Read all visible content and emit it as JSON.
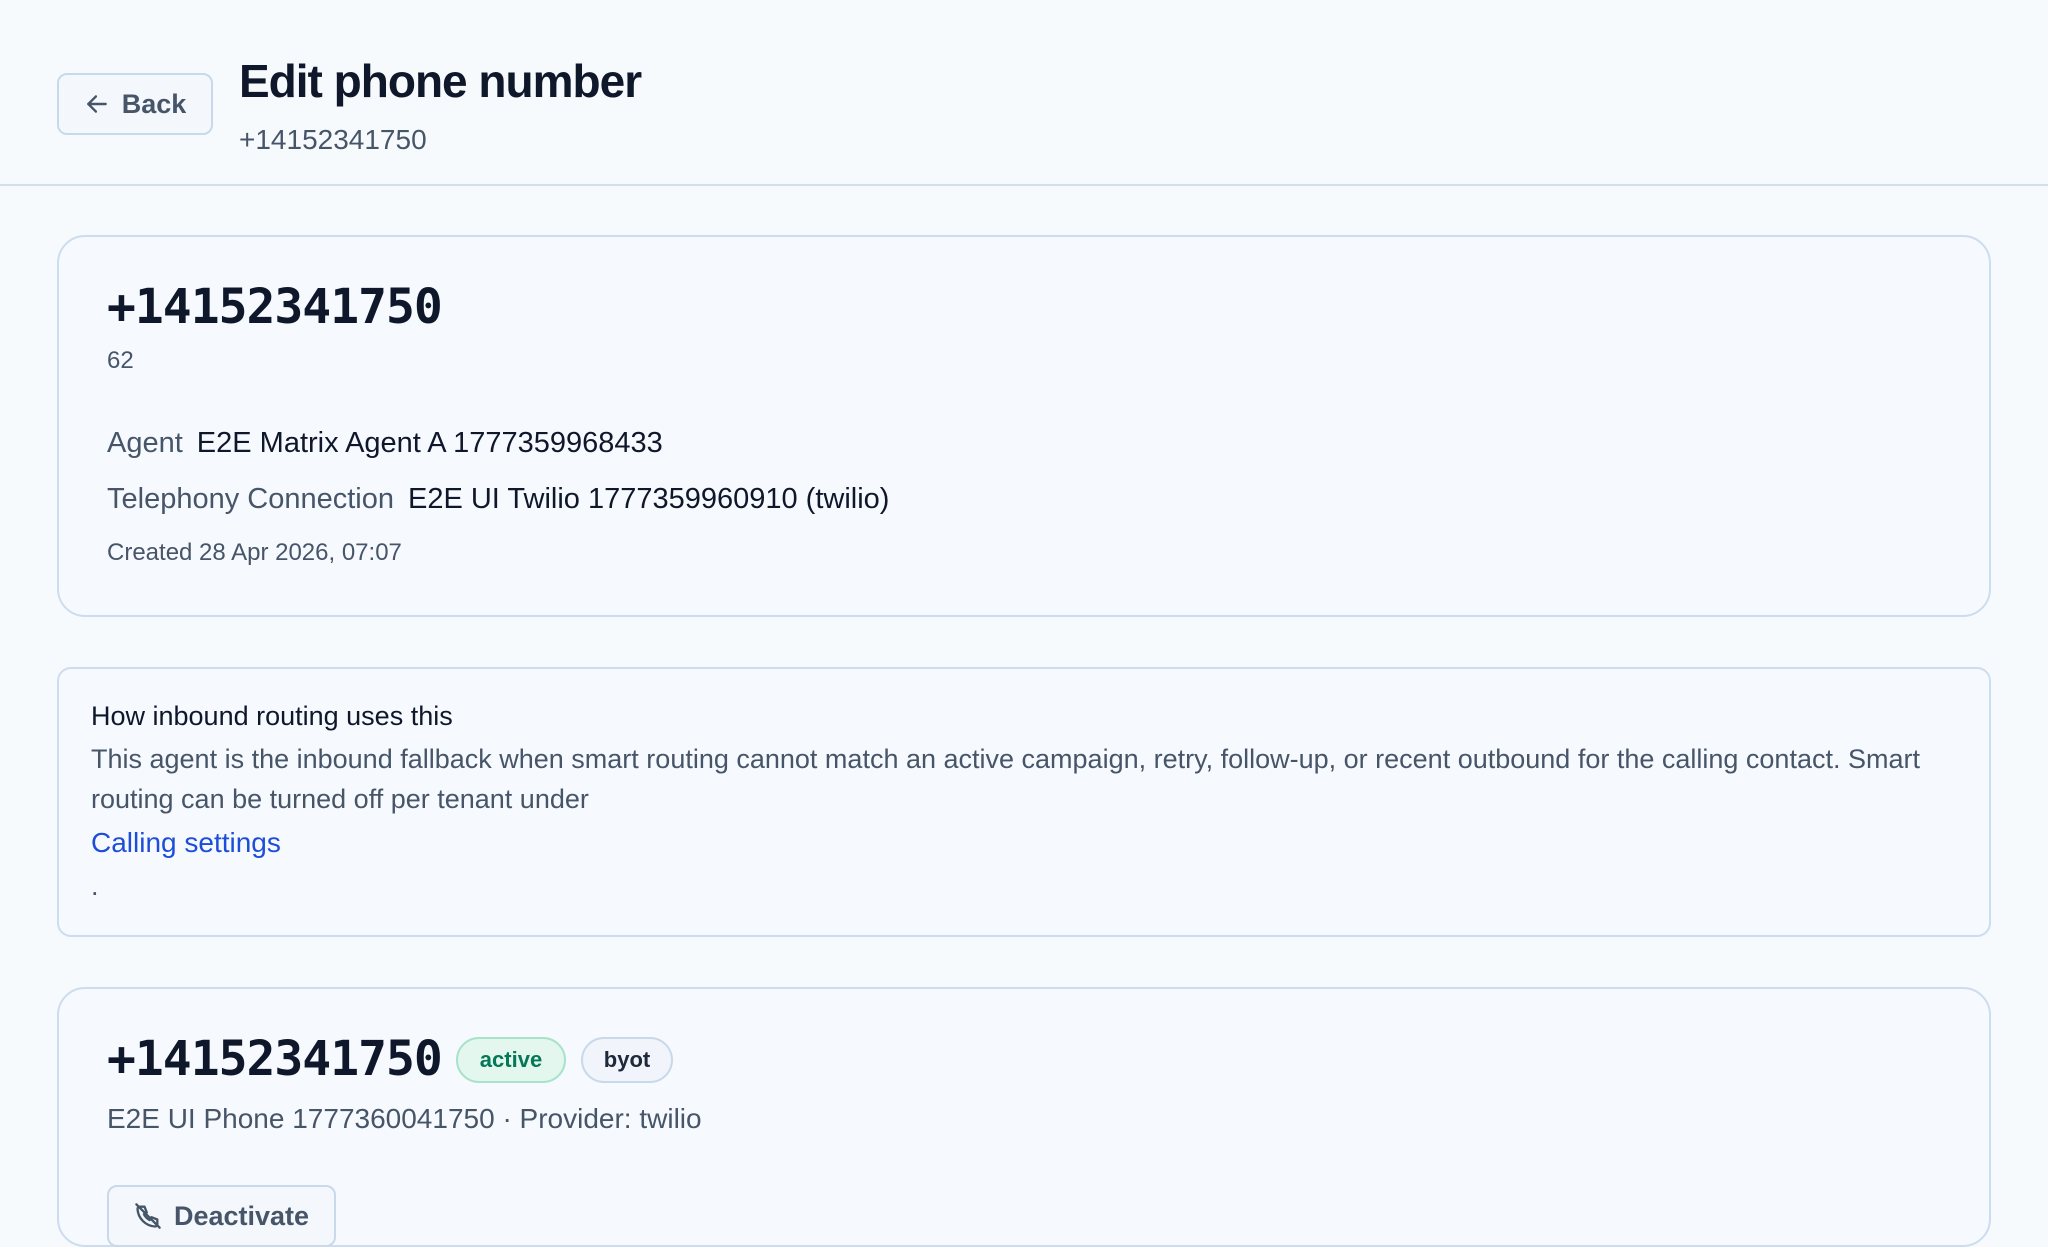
{
  "header": {
    "back_label": "Back",
    "title": "Edit phone number",
    "subtitle": "+14152341750"
  },
  "summary_card": {
    "number": "+14152341750",
    "id": "62",
    "agent_label": "Agent",
    "agent_value": "E2E Matrix Agent A 1777359968433",
    "telephony_label": "Telephony Connection",
    "telephony_value": "E2E UI Twilio 1777359960910 (twilio)",
    "created": "Created 28 Apr 2026, 07:07"
  },
  "routing_info": {
    "title": "How inbound routing uses this",
    "body": "This agent is the inbound fallback when smart routing cannot match an active campaign, retry, follow-up, or recent outbound for the calling contact. Smart routing can be turned off per tenant under",
    "link_label": "Calling settings",
    "trailing": "."
  },
  "number_card": {
    "number": "+14152341750",
    "status_badge": "active",
    "type_badge": "byot",
    "description": "E2E UI Phone 1777360041750 · Provider: twilio",
    "deactivate_label": "Deactivate"
  },
  "icons": {
    "back": "arrow-left-icon",
    "deactivate": "phone-off-icon"
  },
  "colors": {
    "link": "#1d4ed8",
    "active_badge_text": "#047857",
    "active_badge_bg": "#e3f7ee"
  }
}
